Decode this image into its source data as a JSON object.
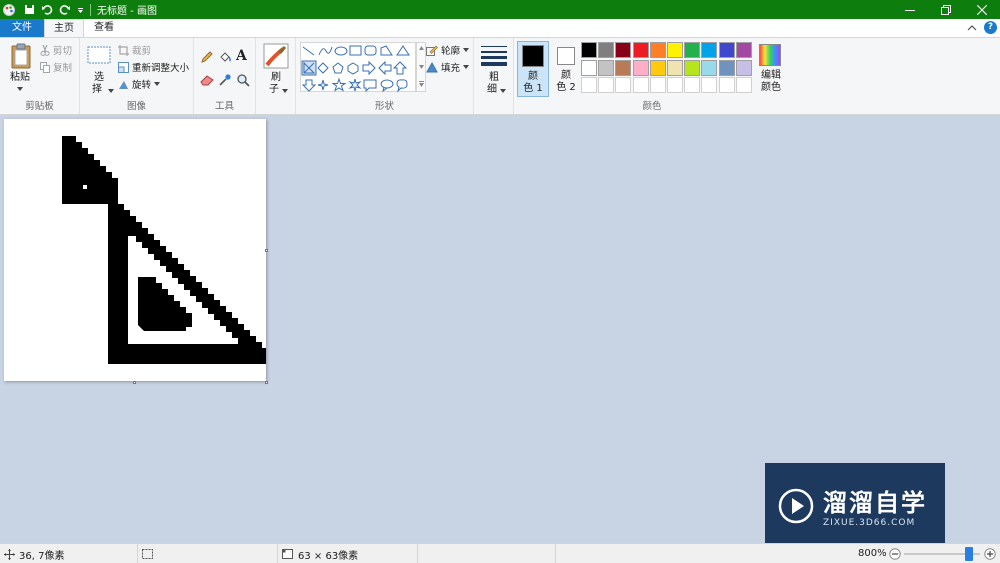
{
  "window": {
    "title": "无标题 - 画图",
    "minimize_icon": "minimize-icon",
    "restore_icon": "restore-icon",
    "close_icon": "close-icon"
  },
  "tabs": {
    "file": "文件",
    "home": "主页",
    "view": "查看",
    "help": "?"
  },
  "clipboard": {
    "paste": "粘贴",
    "cut": "剪切",
    "copy": "复制",
    "group_label": "剪贴板"
  },
  "image": {
    "select_l1": "选",
    "select_l2": "择",
    "crop": "裁剪",
    "resize": "重新调整大小",
    "rotate": "旋转",
    "group_label": "图像"
  },
  "tools": {
    "group_label": "工具"
  },
  "brushes": {
    "label_l1": "刷",
    "label_l2": "子"
  },
  "shapes": {
    "outline": "轮廓",
    "fill": "填充",
    "group_label": "形状"
  },
  "size": {
    "label_l1": "粗",
    "label_l2": "细"
  },
  "colors": {
    "color1_l1": "颜",
    "color1_l2": "色 1",
    "color2_l1": "颜",
    "color2_l2": "色 2",
    "edit_l1": "编辑",
    "edit_l2": "颜色",
    "group_label": "颜色",
    "color1_value": "#000000",
    "color2_value": "#ffffff",
    "palette_row1": [
      "#000000",
      "#7f7f7f",
      "#880015",
      "#ed1c24",
      "#ff7f27",
      "#fff200",
      "#22b14c",
      "#00a2e8",
      "#3f48cc",
      "#a349a4"
    ],
    "palette_row2": [
      "#ffffff",
      "#c3c3c3",
      "#b97a57",
      "#ffaec9",
      "#ffc90e",
      "#efe4b0",
      "#b5e61d",
      "#99d9ea",
      "#7092be",
      "#c8bfe7"
    ]
  },
  "status": {
    "cursor_pos": "36, 7像素",
    "image_size": "63 × 63像素",
    "zoom": "800%",
    "zoom_fraction": 0.86
  },
  "watermark": {
    "title": "溜溜自学",
    "url": "ZIXUE.3D66.COM"
  }
}
